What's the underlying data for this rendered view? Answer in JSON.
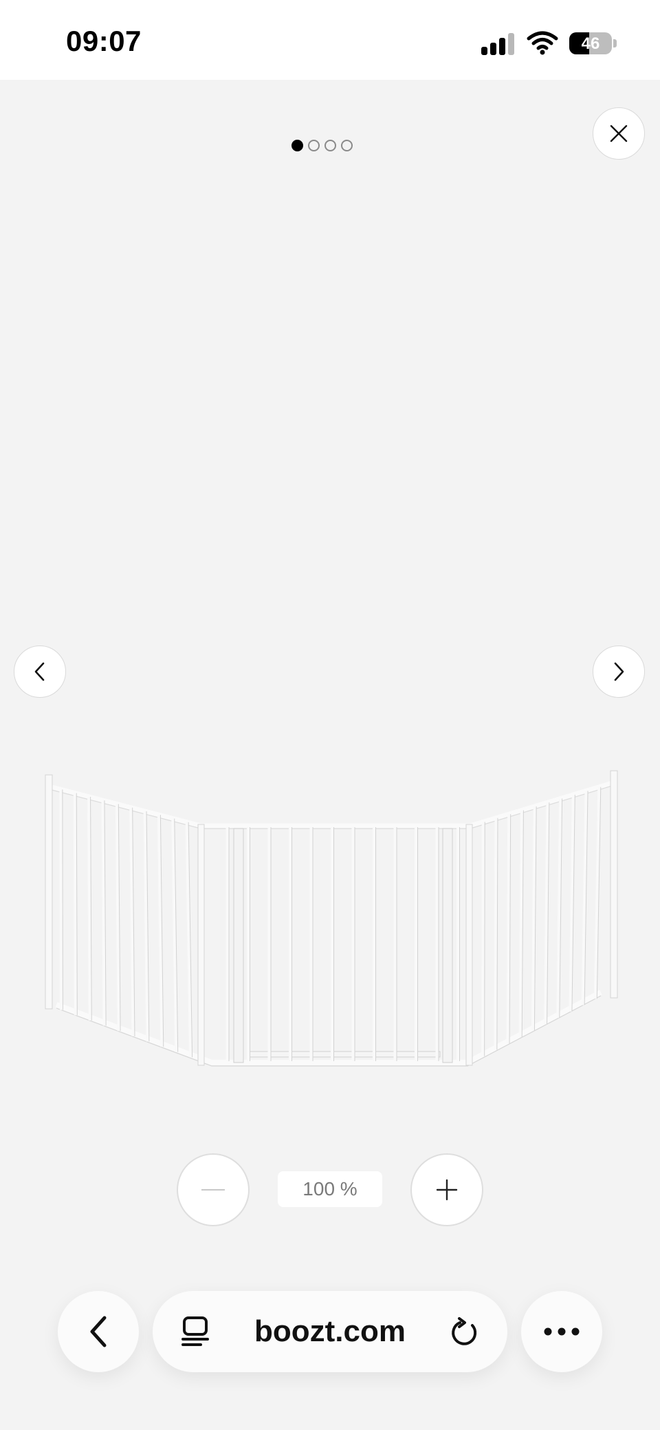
{
  "status_bar": {
    "time": "09:07",
    "battery_level": "46",
    "battery_fraction": 0.46,
    "signal_bars_active": 3,
    "signal_bars_total": 4
  },
  "gallery": {
    "slide_count": 4,
    "active_slide": 1,
    "close_icon": "close-icon",
    "prev_icon": "chevron-left-icon",
    "next_icon": "chevron-right-icon",
    "image_subject": "baby-safety-gate-icon"
  },
  "zoom": {
    "level_text": "100 %",
    "minus_icon": "minus-icon",
    "plus_icon": "plus-icon"
  },
  "browser": {
    "address": "boozt.com",
    "back_icon": "chevron-left-icon",
    "reader_icon": "reader-icon",
    "reload_icon": "reload-icon",
    "more_icon": "ellipsis-icon"
  },
  "colors": {
    "background": "#f3f3f3",
    "status_bar": "#ffffff",
    "active_dot": "#000000",
    "gate": "#f7f7f7"
  }
}
